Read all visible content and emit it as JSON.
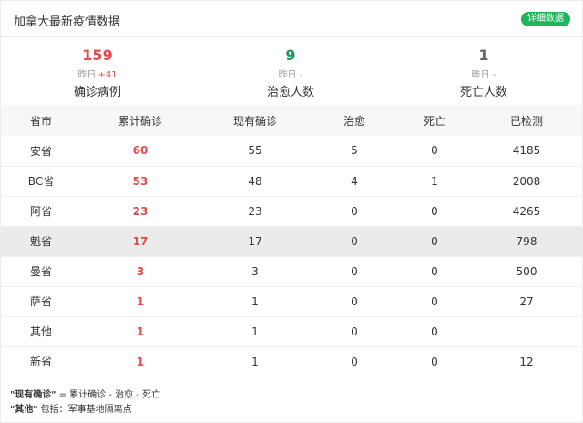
{
  "header": {
    "title": "加拿大最新疫情数据",
    "detail_button": "详细数据"
  },
  "colors": {
    "confirmed": "#e24c4b",
    "cured": "#1a9a56",
    "dead": "#666666",
    "button": "#1db65b"
  },
  "stats": [
    {
      "value": "159",
      "yday_label": "昨日",
      "yday_delta": "+41",
      "label": "确诊病例"
    },
    {
      "value": "9",
      "yday_label": "昨日 -",
      "yday_delta": "",
      "label": "治愈人数"
    },
    {
      "value": "1",
      "yday_label": "昨日 -",
      "yday_delta": "",
      "label": "死亡人数"
    }
  ],
  "table": {
    "headers": [
      "省市",
      "累计确诊",
      "现有确诊",
      "治愈",
      "死亡",
      "已检测"
    ],
    "rows": [
      [
        "安省",
        "60",
        "55",
        "5",
        "0",
        "4185"
      ],
      [
        "BC省",
        "53",
        "48",
        "4",
        "1",
        "2008"
      ],
      [
        "阿省",
        "23",
        "23",
        "0",
        "0",
        "4265"
      ],
      [
        "魁省",
        "17",
        "17",
        "0",
        "0",
        "798"
      ],
      [
        "曼省",
        "3",
        "3",
        "0",
        "0",
        "500"
      ],
      [
        "萨省",
        "1",
        "1",
        "0",
        "0",
        "27"
      ],
      [
        "其他",
        "1",
        "1",
        "0",
        "0",
        ""
      ],
      [
        "新省",
        "1",
        "1",
        "0",
        "0",
        "12"
      ]
    ],
    "highlighted_row": 3
  },
  "footnotes": [
    {
      "term": "\"现有确诊\"",
      "text": " = 累计确诊 - 治愈 - 死亡"
    },
    {
      "term": "\"其他\"",
      "text": " 包括：军事基地隔离点"
    }
  ]
}
